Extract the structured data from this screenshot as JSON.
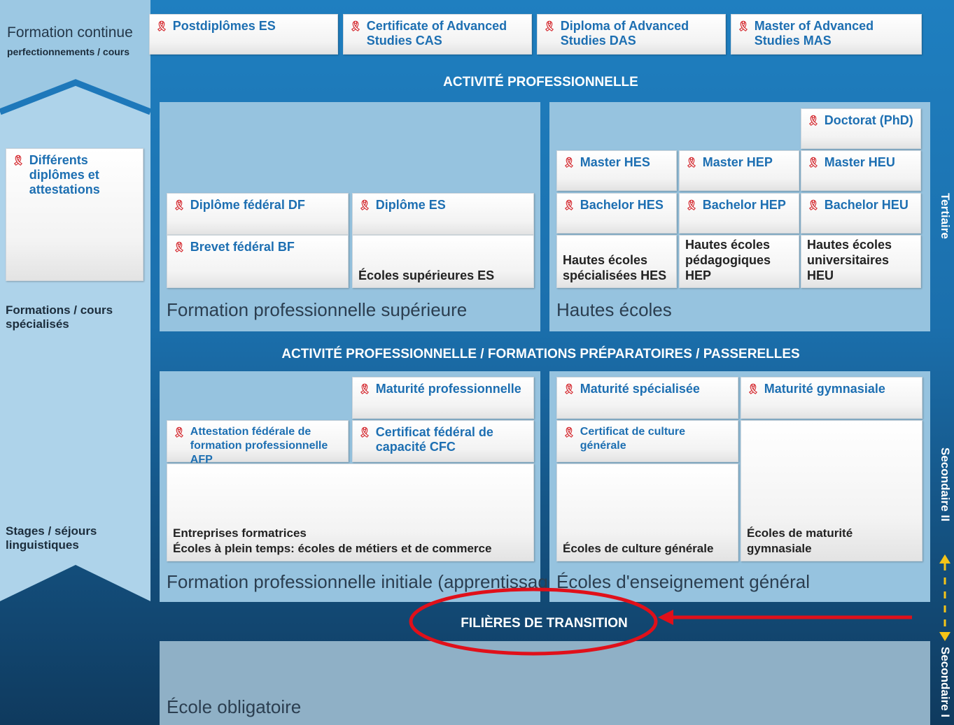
{
  "left_column": {
    "top_title": "Formation continue",
    "top_subtitle": "perfectionnements / cours",
    "card_label": "Différents diplômes et attestations",
    "formations_label": "Formations / cours spécialisés",
    "stages_label": "Stages / séjours linguistiques"
  },
  "continuing": [
    "Postdiplômes ES",
    "Certificate of Advanced Studies CAS",
    "Diploma of Advanced Studies DAS",
    "Master of Advanced Studies MAS"
  ],
  "bands": {
    "top": "ACTIVITÉ PROFESSIONNELLE",
    "middle": "ACTIVITÉ PROFESSIONNELLE / FORMATIONS PRÉPARATOIRES / PASSERELLES",
    "transition": "FILIÈRES DE TRANSITION"
  },
  "tertiary": {
    "fps": {
      "title": "Formation professionnelle supérieure",
      "diplome_df": "Diplôme fédéral DF",
      "brevet_bf": "Brevet fédéral BF",
      "diplome_es": "Diplôme ES",
      "ecoles_es": "Écoles supérieures ES"
    },
    "he": {
      "title": "Hautes écoles",
      "doctorat": "Doctorat (PhD)",
      "master_hes": "Master HES",
      "master_hep": "Master HEP",
      "master_heu": "Master HEU",
      "bachelor_hes": "Bachelor HES",
      "bachelor_hep": "Bachelor HEP",
      "bachelor_heu": "Bachelor HEU",
      "inst_hes": "Hautes écoles spécialisées HES",
      "inst_hep": "Hautes écoles pédagogiques HEP",
      "inst_heu": "Hautes écoles universitaires HEU"
    }
  },
  "secondary2": {
    "fpi": {
      "title": "Formation professionnelle initiale (apprentissage)",
      "maturite_pro": "Maturité professionnelle",
      "afp": "Attestation fédérale de formation professionnelle AFP",
      "cfc": "Certificat fédéral de capacité CFC",
      "entreprises": "Entreprises formatrices",
      "ecoles_plein_temps": "Écoles à plein temps: écoles de métiers et de commerce"
    },
    "eeg": {
      "title": "Écoles d'enseignement général",
      "maturite_spec": "Maturité spécialisée",
      "maturite_gym": "Maturité gymnasiale",
      "certificat_cg": "Certificat de culture générale",
      "ecoles_cg": "Écoles de culture générale",
      "ecoles_mg": "Écoles de maturité gymnasiale"
    }
  },
  "obligatory": {
    "title": "École obligatoire"
  },
  "side_labels": {
    "tertiaire": "Tertiaire",
    "secondaire2": "Secondaire II",
    "secondaire1": "Secondaire I"
  },
  "colors": {
    "highlight_red": "#e0101a",
    "arrow_yellow": "#f5c518"
  }
}
